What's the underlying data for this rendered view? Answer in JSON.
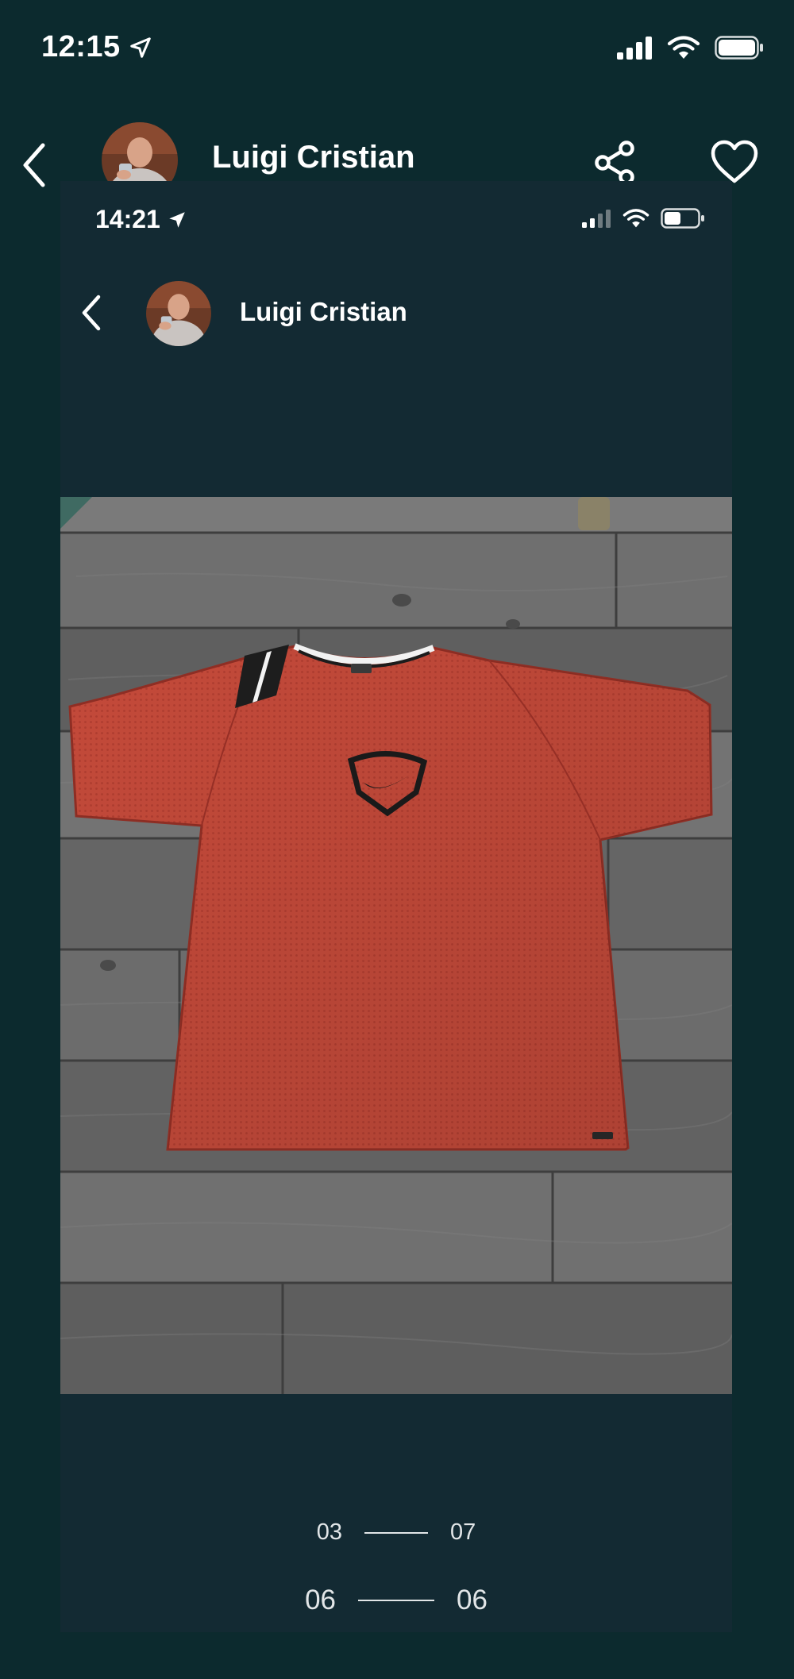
{
  "status_bar": {
    "time": "12:15",
    "location_icon": "location-arrow-icon",
    "signal_icon": "cellular-signal-icon",
    "wifi_icon": "wifi-icon",
    "battery_icon": "battery-full-icon"
  },
  "header": {
    "back_icon": "chevron-left-icon",
    "user_name": "Luigi Cristian",
    "share_icon": "share-icon",
    "like_icon": "heart-icon"
  },
  "embedded_screenshot": {
    "status_bar": {
      "time": "14:21",
      "battery_level": 0.5
    },
    "user_name": "Luigi Cristian",
    "dimensions": [
      {
        "left": "03",
        "right": "07"
      },
      {
        "left": "06",
        "right": "06"
      }
    ]
  },
  "colors": {
    "background": "#0c2a2e",
    "embedded_background": "#132a33",
    "text": "#ffffff",
    "shirt": "#c24a3a",
    "floor": "#6b6b6b"
  }
}
